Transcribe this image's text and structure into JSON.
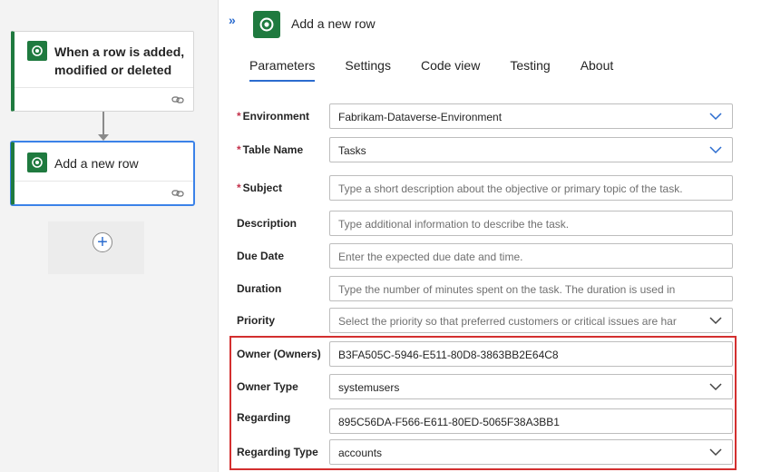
{
  "canvas": {
    "trigger_card": {
      "title": "When a row is added, modified or deleted",
      "icon": "dataverse-icon",
      "footer_icon": "link-icon"
    },
    "action_card": {
      "title": "Add a new row",
      "icon": "dataverse-icon",
      "footer_icon": "link-icon"
    },
    "add_step": {
      "glyph": "+"
    }
  },
  "panel": {
    "collapse_glyph": "»",
    "header_title": "Add a new row",
    "tabs": [
      {
        "label": "Parameters",
        "active": true
      },
      {
        "label": "Settings",
        "active": false
      },
      {
        "label": "Code view",
        "active": false
      },
      {
        "label": "Testing",
        "active": false
      },
      {
        "label": "About",
        "active": false
      }
    ],
    "required_mark": "*",
    "fields": [
      {
        "label": "Environment",
        "required": true,
        "value": "Fabrikam-Dataverse-Environment",
        "placeholder": "",
        "dropdown": true
      },
      {
        "label": "Table Name",
        "required": true,
        "value": "Tasks",
        "placeholder": "",
        "dropdown": true
      },
      {
        "label": "Subject",
        "required": true,
        "value": "",
        "placeholder": "Type a short description about the objective or primary topic of the task.",
        "dropdown": false
      },
      {
        "label": "Description",
        "required": false,
        "value": "",
        "placeholder": "Type additional information to describe the task.",
        "dropdown": false
      },
      {
        "label": "Due Date",
        "required": false,
        "value": "",
        "placeholder": "Enter the expected due date and time.",
        "dropdown": false
      },
      {
        "label": "Duration",
        "required": false,
        "value": "",
        "placeholder": "Type the number of minutes spent on the task. The duration is used in",
        "dropdown": false
      },
      {
        "label": "Priority",
        "required": false,
        "value": "",
        "placeholder": "Select the priority so that preferred customers or critical issues are har",
        "dropdown": true
      },
      {
        "label": "Owner (Owners)",
        "required": false,
        "value": "B3FA505C-5946-E511-80D8-3863BB2E64C8",
        "placeholder": "",
        "dropdown": false
      },
      {
        "label": "Owner Type",
        "required": false,
        "value": "systemusers",
        "placeholder": "",
        "dropdown": true
      },
      {
        "label": "Regarding",
        "required": false,
        "value": "895C56DA-F566-E611-80ED-5065F38A3BB1",
        "placeholder": "",
        "dropdown": false
      },
      {
        "label": "Regarding Type",
        "required": false,
        "value": "accounts",
        "placeholder": "",
        "dropdown": true
      }
    ]
  },
  "colors": {
    "accent": "#2b6ccf",
    "dataverse_green": "#1f7a3f",
    "highlight_red": "#d32f2f",
    "required_red": "#c4314b"
  }
}
